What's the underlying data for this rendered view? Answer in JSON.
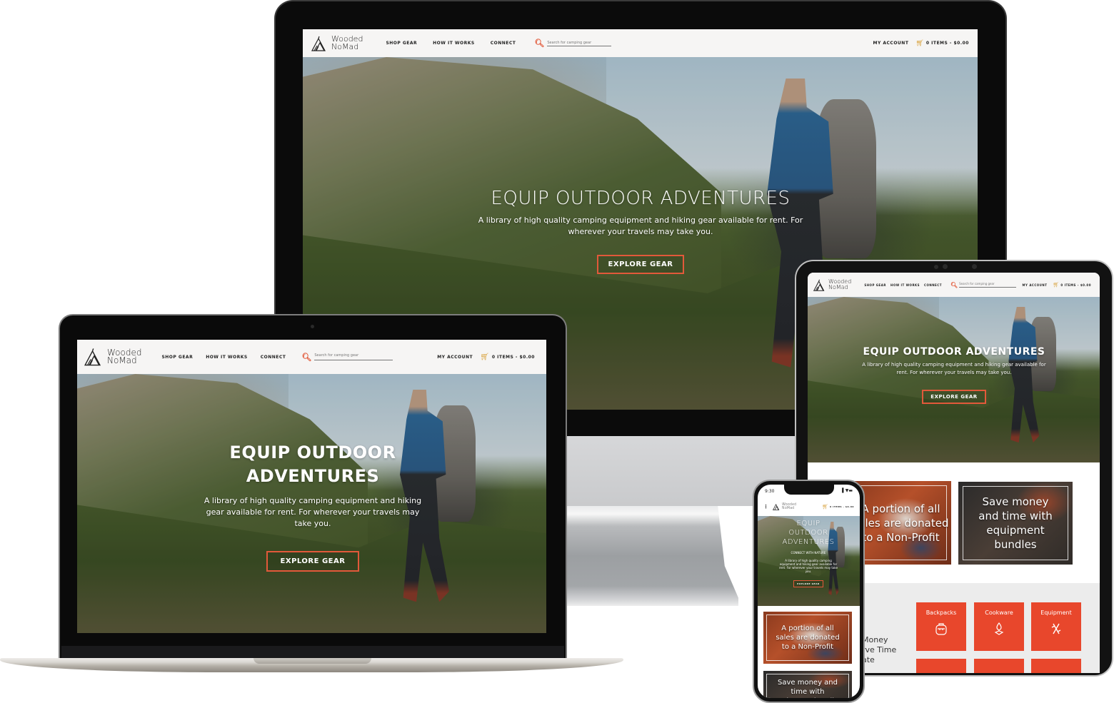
{
  "brand": {
    "logo_line1": "Wooded",
    "logo_line2": "NoMad",
    "accent_color": "#e2593a",
    "category_color": "#e8472c",
    "cart_color": "#d9a441"
  },
  "nav": {
    "items": [
      {
        "label": "SHOP GEAR"
      },
      {
        "label": "HOW IT WORKS"
      },
      {
        "label": "CONNECT"
      }
    ],
    "search_placeholder": "Search for camping gear",
    "account_label": "MY ACCOUNT",
    "cart_label": "0 ITEMS - $0.00"
  },
  "hero": {
    "title": "EQUIP OUTDOOR ADVENTURES",
    "subtitle": "A library of high quality camping equipment and hiking gear available for rent. For wherever your travels may take you.",
    "cta_label": "EXPLORE GEAR",
    "mobile_tagline": "CONNECT WITH NATURE"
  },
  "features": [
    {
      "text": "A portion of all sales are donated to a Non-Profit"
    },
    {
      "text": "Save money and time with equipment bundles"
    }
  ],
  "tablet_side_text": {
    "line1": "Money",
    "line2": "rve Time",
    "line3": "ate"
  },
  "categories": [
    {
      "label": "Backpacks",
      "icon": "backpack-icon",
      "glyph": "⛺"
    },
    {
      "label": "Cookware",
      "icon": "flame-icon",
      "glyph": "🔥"
    },
    {
      "label": "Equipment",
      "icon": "multitool-icon",
      "glyph": "✂"
    }
  ],
  "phone": {
    "time": "9:30",
    "status_icons": "signal wifi battery",
    "cart_label": "0 ITEMS - $0.00"
  },
  "devices": {
    "apple_logo": ""
  }
}
